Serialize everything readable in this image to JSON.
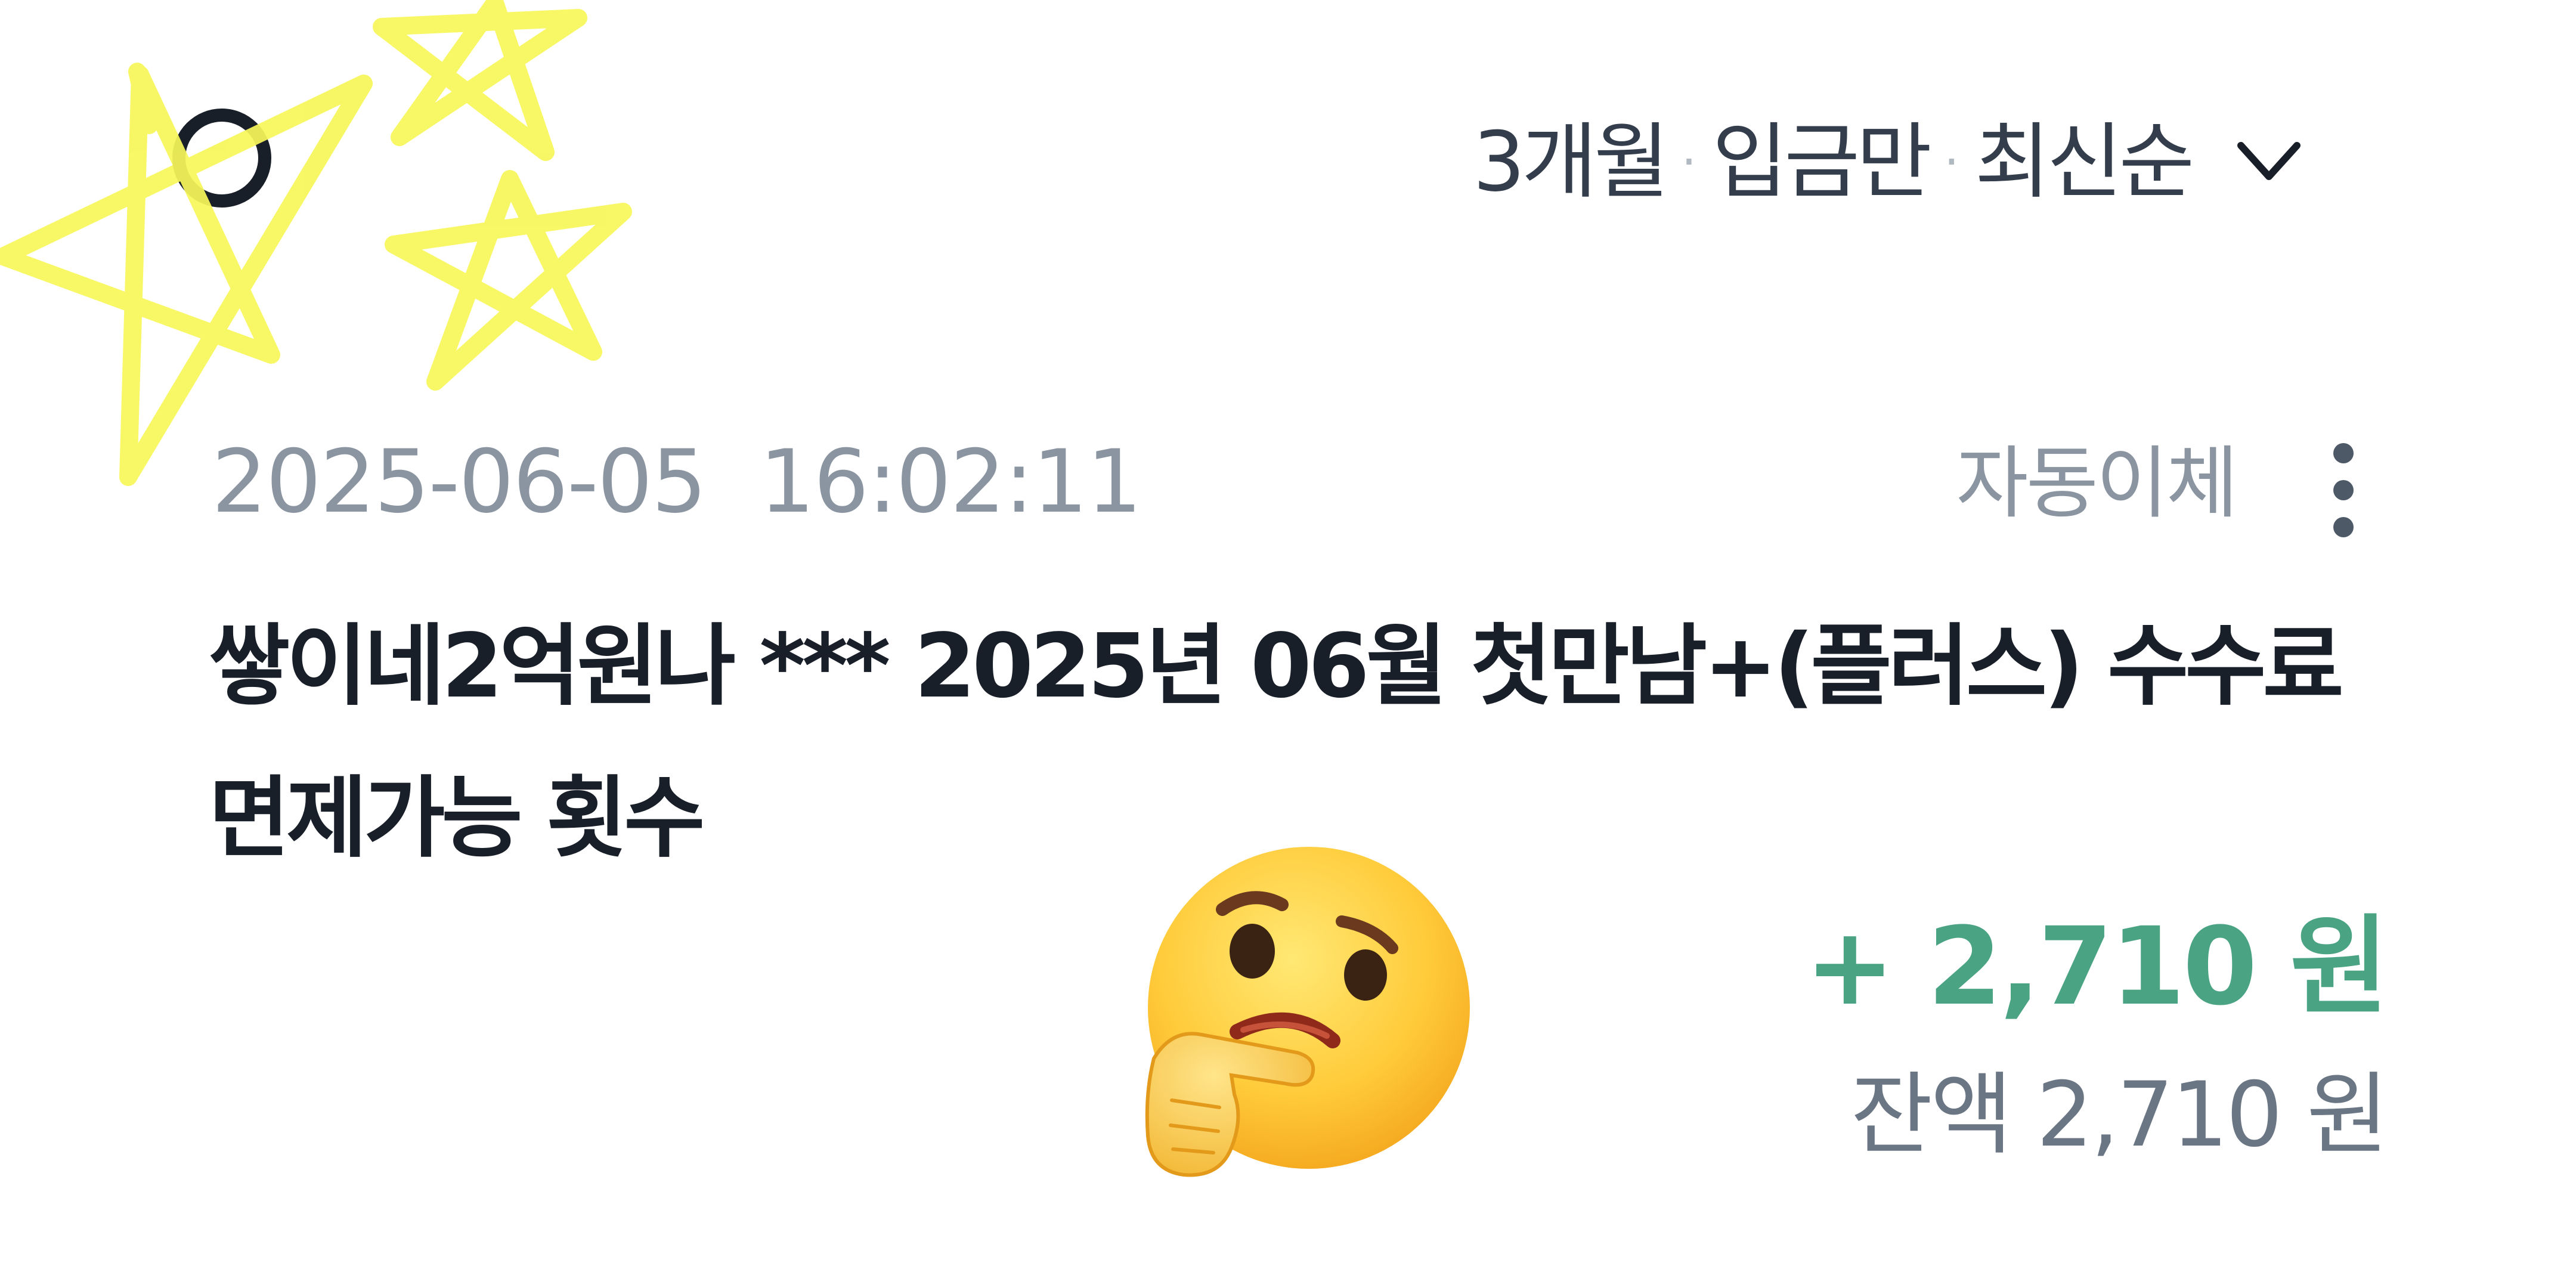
{
  "filter": {
    "period": "3개월",
    "type": "입금만",
    "order": "최신순",
    "separator": "·",
    "dropdown_icon": "chevron-down-icon"
  },
  "transaction": {
    "date": "2025-06-05",
    "time": "16:02:11",
    "type": "자동이체",
    "description": "쌓이네2억원나 *** 2025년 06월 첫만남+(플러스) 수수료 면제가능 횟수",
    "amount": "+ 2,710 원",
    "balance": "잔액 2,710 원",
    "more_icon": "more-vertical-icon"
  },
  "overlays": {
    "stars_icon": "stars-scribble-icon",
    "emoji_icon": "thinking-face-icon"
  },
  "colors": {
    "amount_green": "#4aa383",
    "text_primary": "#191f28",
    "text_secondary": "#8b95a1",
    "star_yellow": "#f7f75a"
  }
}
